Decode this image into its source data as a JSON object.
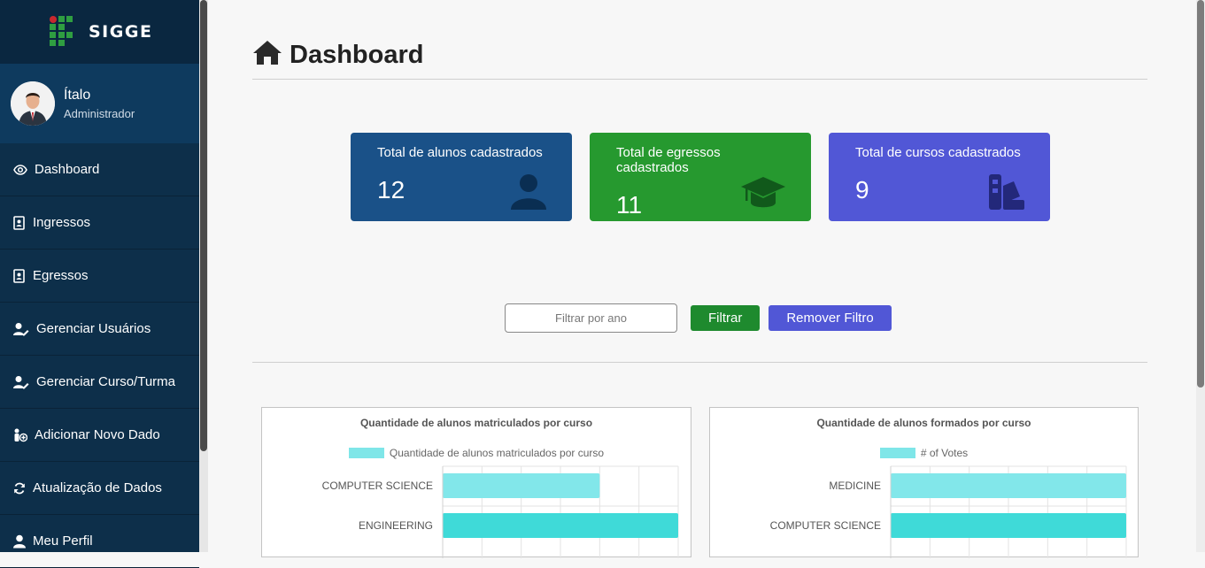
{
  "sidebar": {
    "brand": "SIGGE",
    "user_name": "Ítalo",
    "user_role": "Administrador",
    "items": [
      {
        "label": "Dashboard",
        "icon": "eye-icon"
      },
      {
        "label": "Ingressos",
        "icon": "contact-card-icon"
      },
      {
        "label": "Egressos",
        "icon": "contact-card-icon"
      },
      {
        "label": "Gerenciar Usuários",
        "icon": "user-edit-icon"
      },
      {
        "label": "Gerenciar Curso/Turma",
        "icon": "user-edit-icon"
      },
      {
        "label": "Adicionar Novo Dado",
        "icon": "person-plus-icon"
      },
      {
        "label": "Atualização de Dados",
        "icon": "refresh-icon"
      },
      {
        "label": "Meu Perfil",
        "icon": "user-icon"
      }
    ]
  },
  "header": {
    "title": "Dashboard"
  },
  "cards": [
    {
      "label": "Total de alunos cadastrados",
      "value": "12",
      "color": "#1a5188",
      "icon": "user-icon"
    },
    {
      "label": "Total de egressos cadastrados",
      "value": "11",
      "color": "#26992f",
      "icon": "graduation-cap-icon"
    },
    {
      "label": "Total de cursos cadastrados",
      "value": "9",
      "color": "#5157d6",
      "icon": "swatchbook-icon"
    }
  ],
  "filter": {
    "placeholder": "Filtrar por ano",
    "filter_label": "Filtrar",
    "remove_label": "Remover Filtro"
  },
  "colors": {
    "sidebar": "#0d2f4a",
    "filter_button": "#1e8a2e",
    "remove_button": "#5157d6",
    "bar_fill": "#7fe6e8"
  },
  "chart_data": [
    {
      "type": "bar",
      "orientation": "horizontal",
      "title": "Quantidade de alunos matriculados por curso",
      "legend": "top",
      "series": [
        {
          "name": "Quantidade de alunos matriculados por curso",
          "values": [
            4,
            6
          ]
        }
      ],
      "categories": [
        "COMPUTER SCIENCE",
        "ENGINEERING"
      ],
      "xlim": [
        0,
        6
      ],
      "grid": true
    },
    {
      "type": "bar",
      "orientation": "horizontal",
      "title": "Quantidade de alunos formados por curso",
      "legend": "top",
      "series": [
        {
          "name": "# of Votes",
          "values": [
            6,
            6
          ]
        }
      ],
      "categories": [
        "MEDICINE",
        "COMPUTER SCIENCE"
      ],
      "xlim": [
        0,
        6
      ],
      "grid": true
    }
  ]
}
